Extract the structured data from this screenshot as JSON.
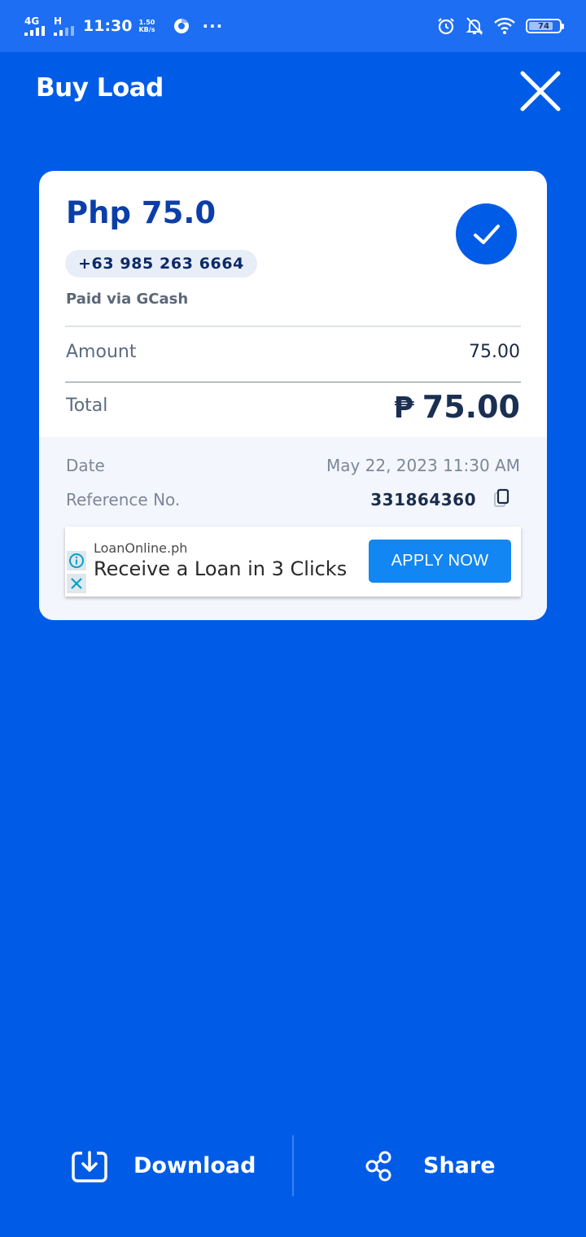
{
  "status_bar": {
    "network_label": "4G",
    "network_label_2": "H",
    "time": "11:30",
    "speed_value": "1.50",
    "speed_unit": "KB/s",
    "battery_level": "74"
  },
  "header": {
    "title": "Buy Load"
  },
  "receipt": {
    "amount_heading": "Php 75.0",
    "phone_number": "+63 985 263 6664",
    "payment_method": "Paid via GCash",
    "amount_label": "Amount",
    "amount_value": "75.00",
    "total_label": "Total",
    "currency_symbol": "₱",
    "total_value": "75.00",
    "date_label": "Date",
    "date_value": "May 22, 2023 11:30 AM",
    "reference_label": "Reference No.",
    "reference_value": "331864360"
  },
  "ad": {
    "source": "LoanOnline.ph",
    "headline": "Receive a Loan in 3 Clicks",
    "cta": "APPLY NOW"
  },
  "actions": {
    "download_label": "Download",
    "share_label": "Share"
  },
  "colors": {
    "background": "#005ce6",
    "status_bar": "#1d6ef2",
    "heading_blue": "#0b3ea8",
    "ad_button": "#1286f2"
  }
}
